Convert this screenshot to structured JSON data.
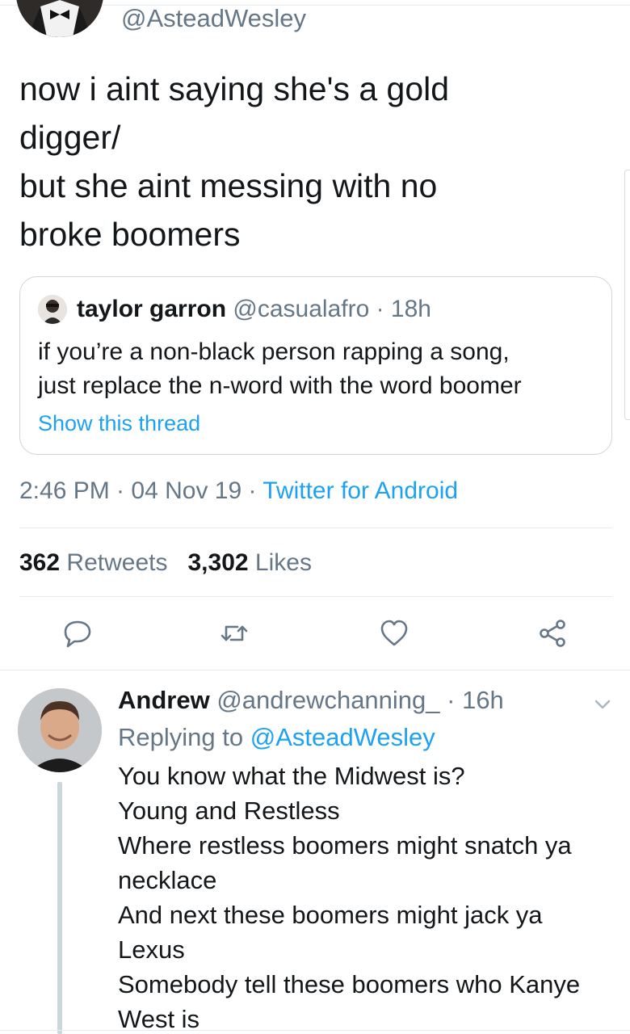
{
  "tweet": {
    "author_handle": "@AsteadWesley",
    "text_lines": [
      "now i aint saying she's a gold",
      "digger/",
      "but she aint messing with no",
      "broke boomers"
    ],
    "quote": {
      "name": "taylor garron",
      "meta": "@casualafro · 18h",
      "body_lines": [
        "if you’re a non-black person rapping a song,",
        "just replace the n-word with the word boomer"
      ],
      "thread_link": "Show this thread"
    },
    "timestamp": "2:46 PM · 04 Nov 19 · ",
    "client": "Twitter for Android",
    "stats": {
      "retweets_count": "362",
      "retweets_label": "Retweets",
      "likes_count": "3,302",
      "likes_label": "Likes"
    },
    "actions": {
      "reply_icon": "reply-icon",
      "retweet_icon": "retweet-icon",
      "like_icon": "heart-icon",
      "share_icon": "share-icon"
    }
  },
  "reply": {
    "name": "Andrew",
    "meta": "@andrewchanning_ · 16h",
    "replying_prefix": "Replying to ",
    "replying_mention": "@AsteadWesley",
    "body_lines": [
      "You know what the Midwest is?",
      "Young and Restless",
      "Where restless boomers might snatch ya",
      "necklace",
      "And next these boomers might jack ya",
      "Lexus",
      "Somebody tell these boomers who Kanye",
      "West is"
    ]
  },
  "colors": {
    "accent": "#1da1f2",
    "secondary_text": "#657786",
    "primary_text": "#14171a",
    "border": "#e6ecf0"
  }
}
